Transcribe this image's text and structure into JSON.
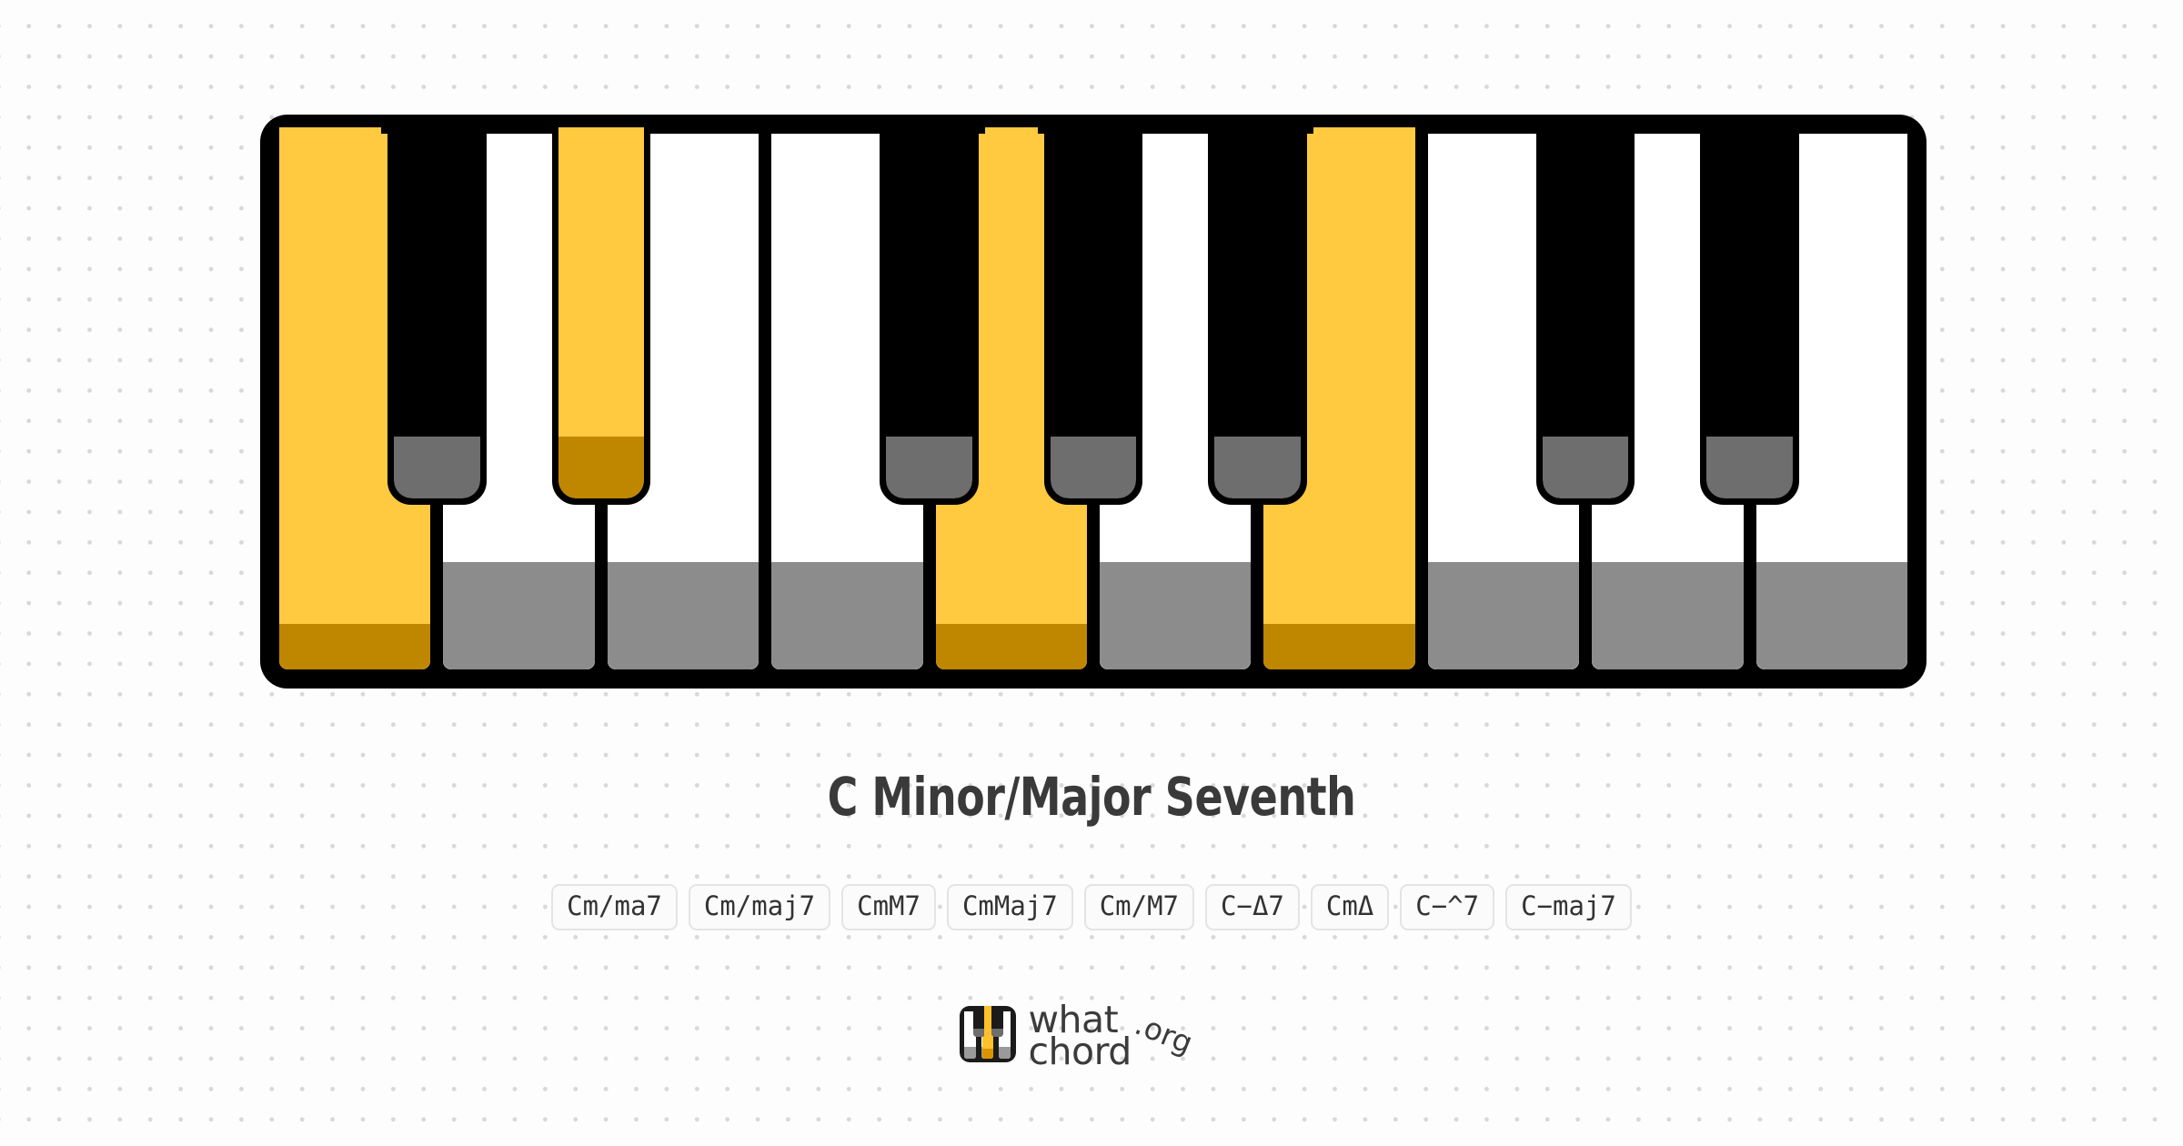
{
  "chord": {
    "title": "C Minor/Major Seventh",
    "root": "C",
    "aliases": [
      "Cm/ma7",
      "Cm/maj7",
      "CmM7",
      "CmMaj7",
      "Cm/M7",
      "C−Δ7",
      "CmΔ",
      "C−^7",
      "C−maj7"
    ]
  },
  "keyboard": {
    "white_key_count": 10,
    "white_keys": [
      {
        "note": "C",
        "highlighted": true
      },
      {
        "note": "D",
        "highlighted": false
      },
      {
        "note": "E",
        "highlighted": false
      },
      {
        "note": "F",
        "highlighted": false
      },
      {
        "note": "G",
        "highlighted": true
      },
      {
        "note": "A",
        "highlighted": false
      },
      {
        "note": "B",
        "highlighted": true
      },
      {
        "note": "C",
        "highlighted": false
      },
      {
        "note": "D",
        "highlighted": false
      },
      {
        "note": "E",
        "highlighted": false
      }
    ],
    "black_keys": [
      {
        "note": "C#",
        "after_white_index": 0,
        "highlighted": false
      },
      {
        "note": "D#",
        "after_white_index": 1,
        "highlighted": true
      },
      {
        "note": "F#",
        "after_white_index": 3,
        "highlighted": false
      },
      {
        "note": "G#",
        "after_white_index": 4,
        "highlighted": false
      },
      {
        "note": "A#",
        "after_white_index": 5,
        "highlighted": false
      },
      {
        "note": "C#",
        "after_white_index": 7,
        "highlighted": false
      },
      {
        "note": "D#",
        "after_white_index": 8,
        "highlighted": false
      }
    ]
  },
  "colors": {
    "highlight": "#ffc940",
    "highlight_shadow": "#bf8700",
    "white_key": "#ffffff",
    "white_key_shadow": "#8c8c8c",
    "black_key": "#000000",
    "black_key_shadow": "#6e6e6e",
    "title_text": "#3a3a3a",
    "background": "#fdfdfd",
    "dot_grid": "#d8d8d8"
  },
  "logo": {
    "icon": "piano-keyboard-icon",
    "line1": "what",
    "line2": "chord",
    "tld": ".org"
  }
}
